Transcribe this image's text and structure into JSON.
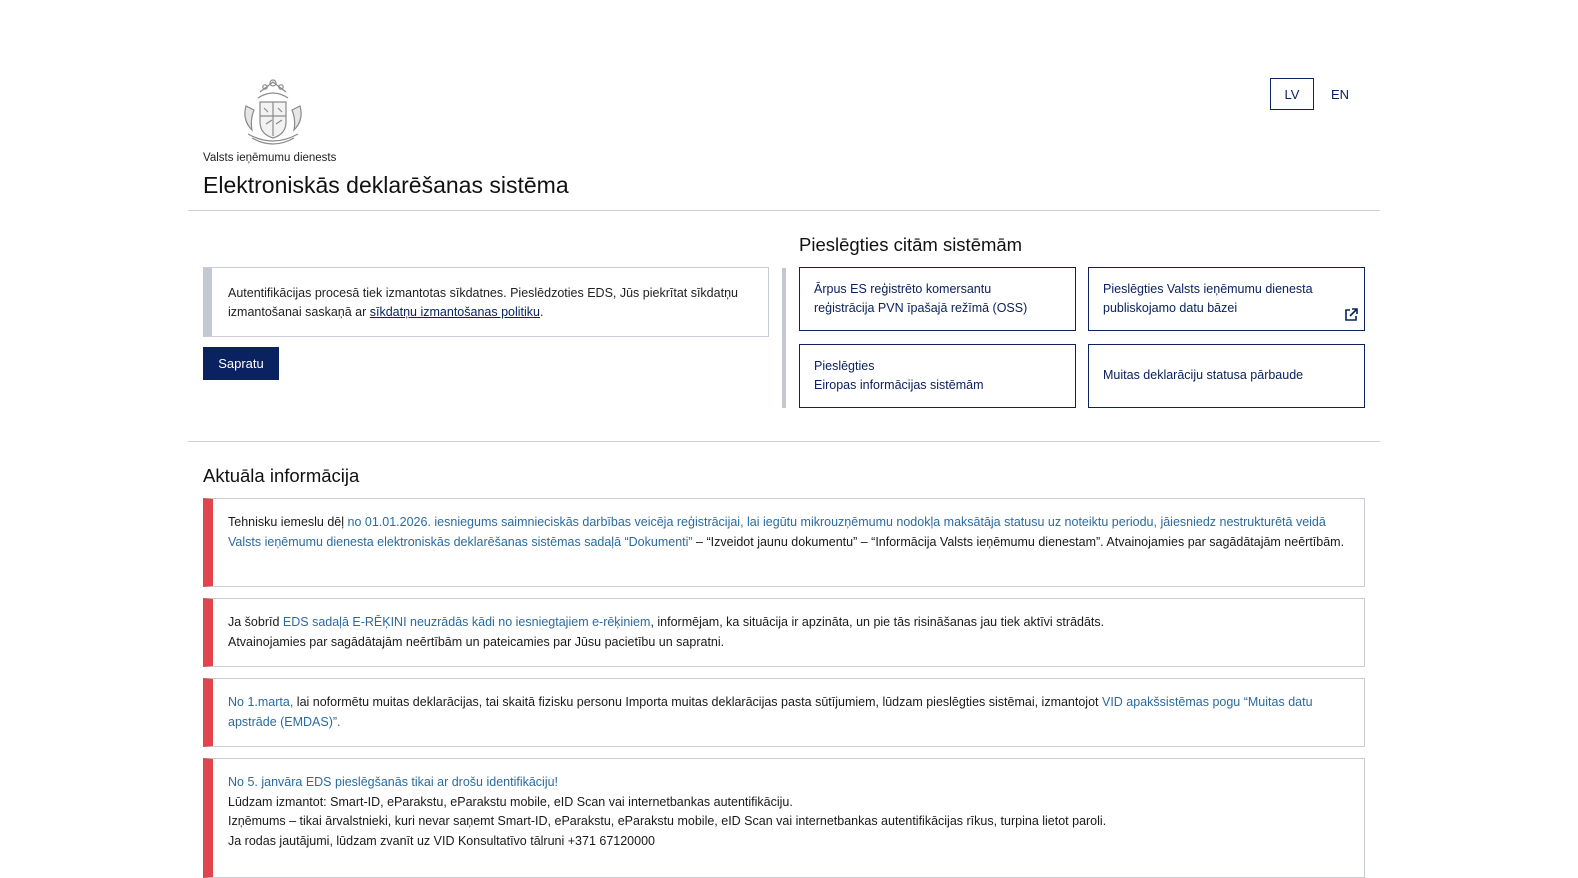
{
  "header": {
    "org_name": "Valsts ieņēmumu dienests",
    "site_title": "Elektroniskās deklarēšanas sistēma",
    "languages": [
      "LV",
      "EN"
    ],
    "active_language": "LV"
  },
  "cookie_notice": {
    "text": "Autentifikācijas procesā tiek izmantotas sīkdatnes. Pieslēdzoties EDS, Jūs piekrītat sīkdatņu izmantošanai saskaņā ar ",
    "link": "sīkdatņu izmantošanas politiku",
    "end": ".",
    "button": "Sapratu"
  },
  "connect": {
    "title": "Pieslēgties citām sistēmām",
    "tiles": [
      {
        "line1": "Ārpus ES reģistrēto komersantu",
        "line2": "reģistrācija PVN īpašajā režīmā (OSS)",
        "icon": ""
      },
      {
        "line1": "Pieslēgties Valsts ieņēmumu dienesta",
        "line2": "publiskojamo datu bāzei",
        "icon": "external-link-icon"
      },
      {
        "line1": "Pieslēgties",
        "line2": "Eiropas informācijas sistēmām",
        "icon": ""
      },
      {
        "line1": "Muitas deklarāciju statusa pārbaude",
        "line2": "",
        "icon": ""
      }
    ]
  },
  "news": {
    "title": "Aktuāla informācija",
    "items": [
      {
        "p1": "Tehnisku iemeslu dēļ ",
        "hl1": "no 01.01.2026. iesniegums saimnieciskās darbības veicēja reģistrācijai, lai iegūtu mikrouzņēmumu nodokļa maksātāja statusu uz noteiktu periodu, jāiesniedz nestrukturētā veidā Valsts ieņēmumu dienesta elektroniskās deklarēšanas sistēmas sadaļā “Dokumenti”",
        "p2": " – “Izveidot jaunu dokumentu” – “Informācija Valsts ieņēmumu dienestam”. Atvainojamies par sagādātajām neērtībām."
      },
      {
        "p1": "Ja šobrīd ",
        "hl1": "EDS sadaļā E-RĒĶINI neuzrādās kādi no iesniegtajiem e-rēķiniem",
        "p2": ", informējam, ka situācija ir apzināta, un pie tās risināšanas jau tiek aktīvi strādāts.",
        "line2": "Atvainojamies par sagādātajām neērtībām un pateicamies par Jūsu pacietību un sapratni."
      },
      {
        "hl1": "No 1.marta,",
        "p1": " lai noformētu muitas deklarācijas, tai skaitā fizisku personu Importa muitas deklarācijas pasta sūtījumiem, lūdzam pieslēgties sistēmai, izmantojot ",
        "hl2": "VID apakšsistēmas pogu “Muitas datu apstrāde (EMDAS)”."
      },
      {
        "hl1": "No 5. janvāra EDS pieslēgšanās tikai ar drošu identifikāciju!",
        "line2": "Lūdzam izmantot:  Smart-ID, eParakstu, eParakstu mobile, eID Scan vai internetbankas autentifikāciju.",
        "line3": "Izņēmums – tikai ārvalstnieki, kuri nevar saņemt Smart-ID, eParakstu, eParakstu mobile, eID Scan vai internetbankas autentifikācijas rīkus, turpina lietot paroli.",
        "line4": "Ja rodas jautājumi, lūdzam zvanīt uz VID Konsultatīvo tālruni +371 67120000"
      }
    ]
  }
}
